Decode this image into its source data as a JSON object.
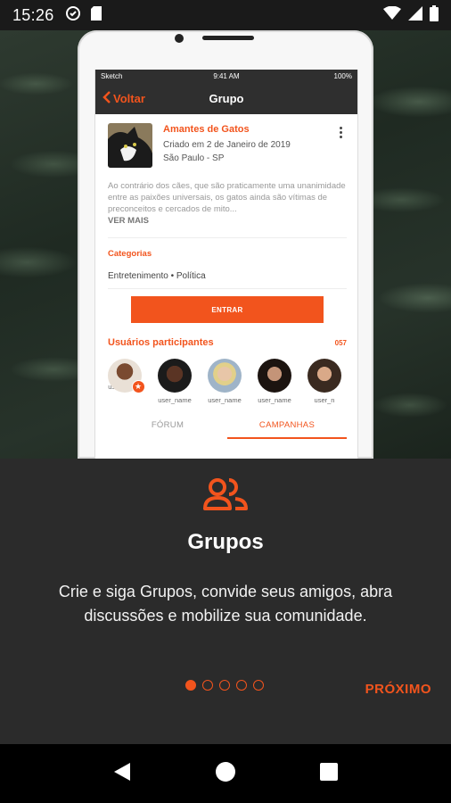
{
  "status_bar": {
    "time": "15:26"
  },
  "phone_screen": {
    "ios_status": {
      "carrier": "Sketch",
      "time": "9:41 AM",
      "battery": "100%"
    },
    "nav": {
      "back_label": "Voltar",
      "title": "Grupo"
    },
    "group": {
      "name": "Amantes de Gatos",
      "created": "Criado em 2 de Janeiro de 2019",
      "location": "São Paulo - SP",
      "description": "Ao contrário dos cães, que são praticamente uma unanimidade entre as paixões universais, os gatos ainda são vítimas de preconceitos e cercados de mito...",
      "see_more": "VER MAIS"
    },
    "categories_label": "Categorias",
    "categories": "Entretenimento  •  Política",
    "join_button": "ENTRAR",
    "participants_label": "Usuários participantes",
    "participants_count": "057",
    "participants": [
      {
        "name": "user_name"
      },
      {
        "name": "user_name"
      },
      {
        "name": "user_name"
      },
      {
        "name": "user_name"
      },
      {
        "name": "user_n"
      }
    ],
    "tabs": [
      {
        "label": "FÓRUM"
      },
      {
        "label": "CAMPANHAS"
      }
    ]
  },
  "onboarding": {
    "icon": "group-icon",
    "title": "Grupos",
    "text": "Crie e siga Grupos, convide seus amigos, abra discussões e mobilize sua comunidade.",
    "page_index": 1,
    "page_count": 5,
    "next_label": "PRÓXIMO"
  },
  "colors": {
    "accent": "#f2541d",
    "panel": "#2b2b2b",
    "nav": "#2f2f2f"
  }
}
